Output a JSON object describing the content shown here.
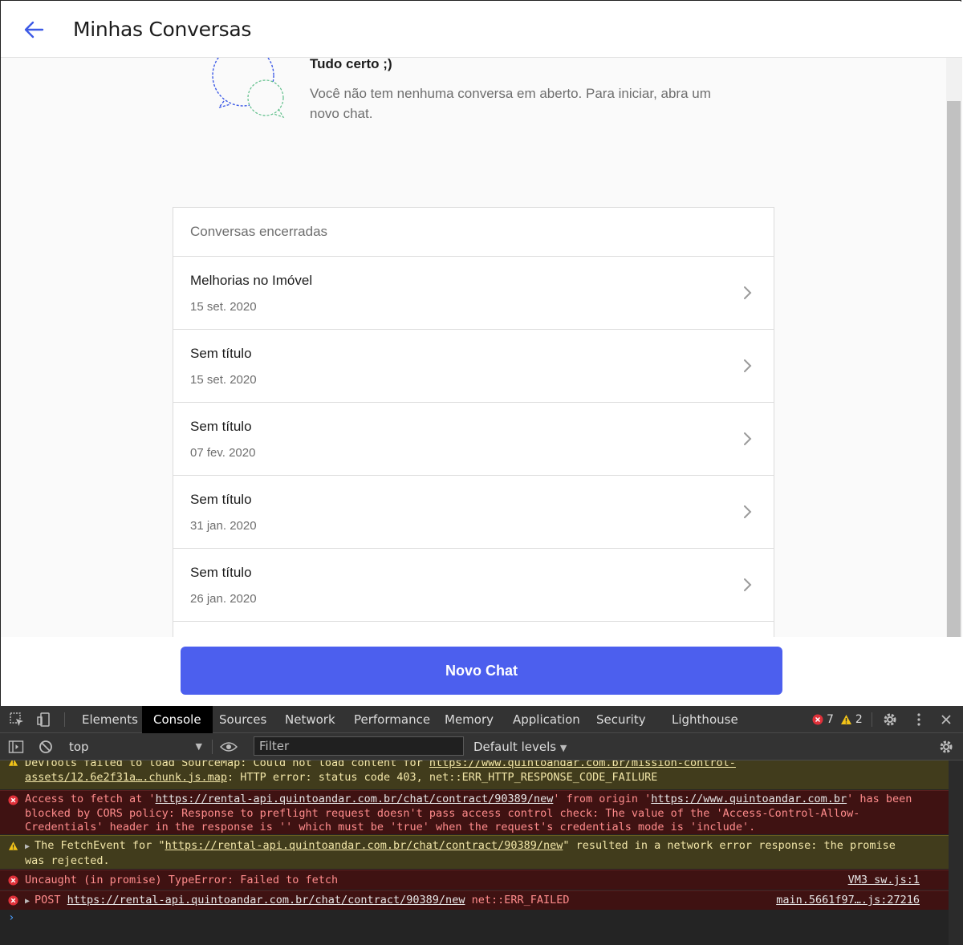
{
  "app": {
    "title": "Minhas Conversas",
    "empty_state": {
      "title": "Tudo certo ;)",
      "message": "Você não tem nenhuma conversa em aberto. Para iniciar, abra um novo chat."
    },
    "closed_section": {
      "header": "Conversas encerradas",
      "items": [
        {
          "title": "Melhorias no Imóvel",
          "date": "15 set. 2020"
        },
        {
          "title": "Sem título",
          "date": "15 set. 2020"
        },
        {
          "title": "Sem título",
          "date": "07 fev. 2020"
        },
        {
          "title": "Sem título",
          "date": "31 jan. 2020"
        },
        {
          "title": "Sem título",
          "date": "26 jan. 2020"
        }
      ]
    },
    "new_chat_label": "Novo Chat",
    "accent_color": "#4c5fee"
  },
  "devtools": {
    "tabs": [
      "Elements",
      "Console",
      "Sources",
      "Network",
      "Performance",
      "Memory",
      "Application",
      "Security",
      "Lighthouse"
    ],
    "active_tab": "Console",
    "error_count": "7",
    "warning_count": "2",
    "context": "top",
    "filter_placeholder": "Filter",
    "levels_label": "Default levels",
    "messages": {
      "m1": {
        "text_a": "DevTools failed to load SourceMap: Could not load content for ",
        "url": "https://www.quintoandar.com.br/mission-control-assets/12.6e2f31a….chunk.js.map",
        "text_b": ": HTTP error: status code 403, net::ERR_HTTP_RESPONSE_CODE_FAILURE"
      },
      "m2": {
        "text_a": "Access to fetch at '",
        "url1": "https://rental-api.quintoandar.com.br/chat/contract/90389/new",
        "text_b": "' from origin '",
        "url2": "https://www.quintoandar.com.br",
        "text_c": "' has been blocked by CORS policy: Response to preflight request doesn't pass access control check: The value of the 'Access-Control-Allow-Credentials' header in the response is '' which must be 'true' when the request's credentials mode is 'include'."
      },
      "m3": {
        "text_a": "The FetchEvent for \"",
        "url": "https://rental-api.quintoandar.com.br/chat/contract/90389/new",
        "text_b": "\" resulted in a network error response: the promise was rejected."
      },
      "m4": {
        "text": "Uncaught (in promise) TypeError: Failed to fetch",
        "source": "VM3 sw.js:1"
      },
      "m5": {
        "method": "POST",
        "url": "https://rental-api.quintoandar.com.br/chat/contract/90389/new",
        "status": "net::ERR_FAILED",
        "source": "main.5661f97….js:27216"
      }
    }
  }
}
